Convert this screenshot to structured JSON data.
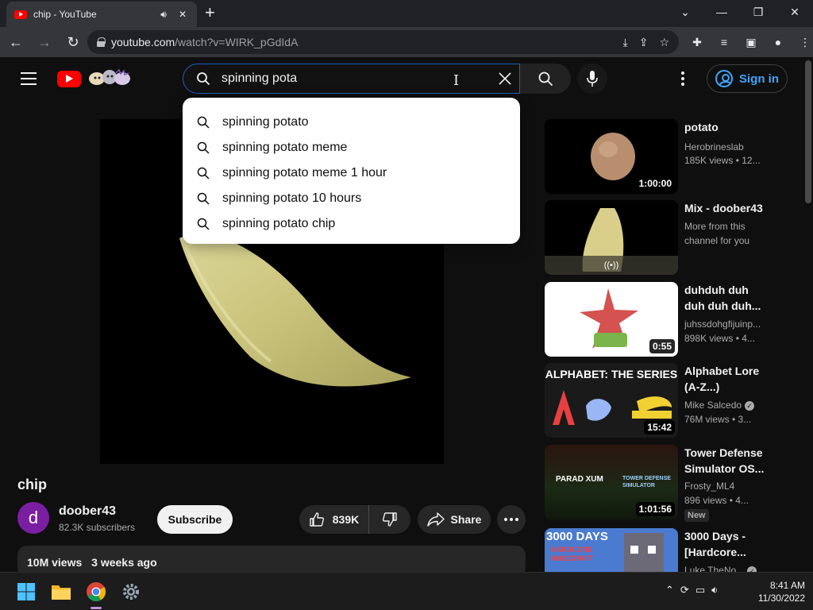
{
  "browser": {
    "tab_title": "chip - YouTube",
    "url_host": "youtube.com",
    "url_path": "/watch?v=WIRK_pGdIdA"
  },
  "header": {
    "search_value": "spinning pota",
    "signin_label": "Sign in"
  },
  "suggestions": [
    "spinning potato",
    "spinning potato meme",
    "spinning potato meme 1 hour",
    "spinning potato 10 hours",
    "spinning potato chip"
  ],
  "video": {
    "title": "chip",
    "channel_initial": "d",
    "channel": "doober43",
    "subscribers": "82.3K subscribers",
    "subscribe_label": "Subscribe",
    "likes": "839K",
    "share_label": "Share",
    "views": "10M views",
    "date": "3 weeks ago"
  },
  "recommendations": [
    {
      "title": "potato",
      "channel": "Herobrineslab",
      "meta": "185K views • 12...",
      "duration": "1:00:00"
    },
    {
      "title": "Mix - doober43",
      "channel": "More from this",
      "meta": "channel for you",
      "duration": ""
    },
    {
      "title": "duhduh duh duh duh duh...",
      "channel": "juhssdohgfijuinp...",
      "meta": "898K views • 4...",
      "duration": "0:55"
    },
    {
      "title": "Alphabet Lore (A-Z...)",
      "channel": "Mike Salcedo",
      "meta": "76M views • 3...",
      "duration": "15:42",
      "thumb_text": "ALPHABET: THE SERIES"
    },
    {
      "title": "Tower Defense Simulator OS...",
      "channel": "Frosty_ML4",
      "meta": "896 views • 4...",
      "duration": "1:01:56",
      "badge": "New",
      "thumb_text_left": "PARAD XUM",
      "thumb_text_right": "TOWER DEFENSE SIMULATOR"
    },
    {
      "title": "3000 Days - [Hardcore...",
      "channel": "Luke TheNo...",
      "meta": "",
      "duration": "",
      "thumb_text": "3000 DAYS",
      "thumb_sub": "HARDCORE MINECRAFT"
    }
  ],
  "taskbar": {
    "time": "8:41 AM",
    "date": "11/30/2022"
  },
  "colors": {
    "accent_blue": "#3ea6ff",
    "yt_red": "#ff0000",
    "bg": "#0f0f0f",
    "channel_avatar": "#7b1fa2"
  }
}
